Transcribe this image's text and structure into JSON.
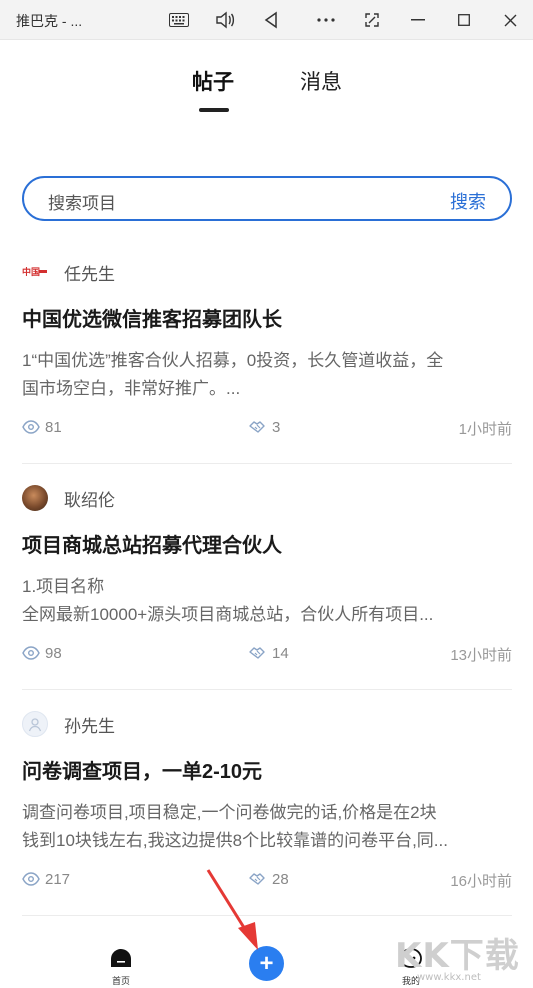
{
  "window": {
    "title": "推巴克 - ..."
  },
  "tabs": [
    {
      "label": "帖子",
      "active": true
    },
    {
      "label": "消息",
      "active": false
    }
  ],
  "search": {
    "placeholder": "搜索项目",
    "button_label": "搜索"
  },
  "posts": [
    {
      "author": "任先生",
      "avatar": "logo-avatar",
      "title": "中国优选微信推客招募团队长",
      "body_lines": [
        "1“中国优选”推客合伙人招募，0投资，长久管道收益，全",
        "国市场空白，非常好推广。..."
      ],
      "views": "81",
      "likes": "3",
      "time": "1小时前"
    },
    {
      "author": "耿绍伦",
      "avatar": "photo-avatar",
      "title": "项目商城总站招募代理合伙人",
      "body_lines": [
        "1.项目名称",
        "全网最新10000+源头项目商城总站，合伙人所有项目..."
      ],
      "views": "98",
      "likes": "14",
      "time": "13小时前"
    },
    {
      "author": "孙先生",
      "avatar": "default-avatar",
      "title": "问卷调查项目，一单2-10元",
      "body_lines": [
        "调查问卷项目,项目稳定,一个问卷做完的话,价格是在2块",
        "钱到10块钱左右,我这边提供8个比较靠谱的问卷平台,同..."
      ],
      "views": "217",
      "likes": "28",
      "time": "16小时前"
    }
  ],
  "bottom_nav": {
    "home_label": "首页",
    "add_label": "+",
    "me_label": "我的"
  },
  "watermark": {
    "text": "KK下载",
    "url": "www.kkx.net"
  },
  "colors": {
    "accent": "#2a6fd6",
    "add_button": "#2a7ef0",
    "arrow": "#e53935"
  }
}
